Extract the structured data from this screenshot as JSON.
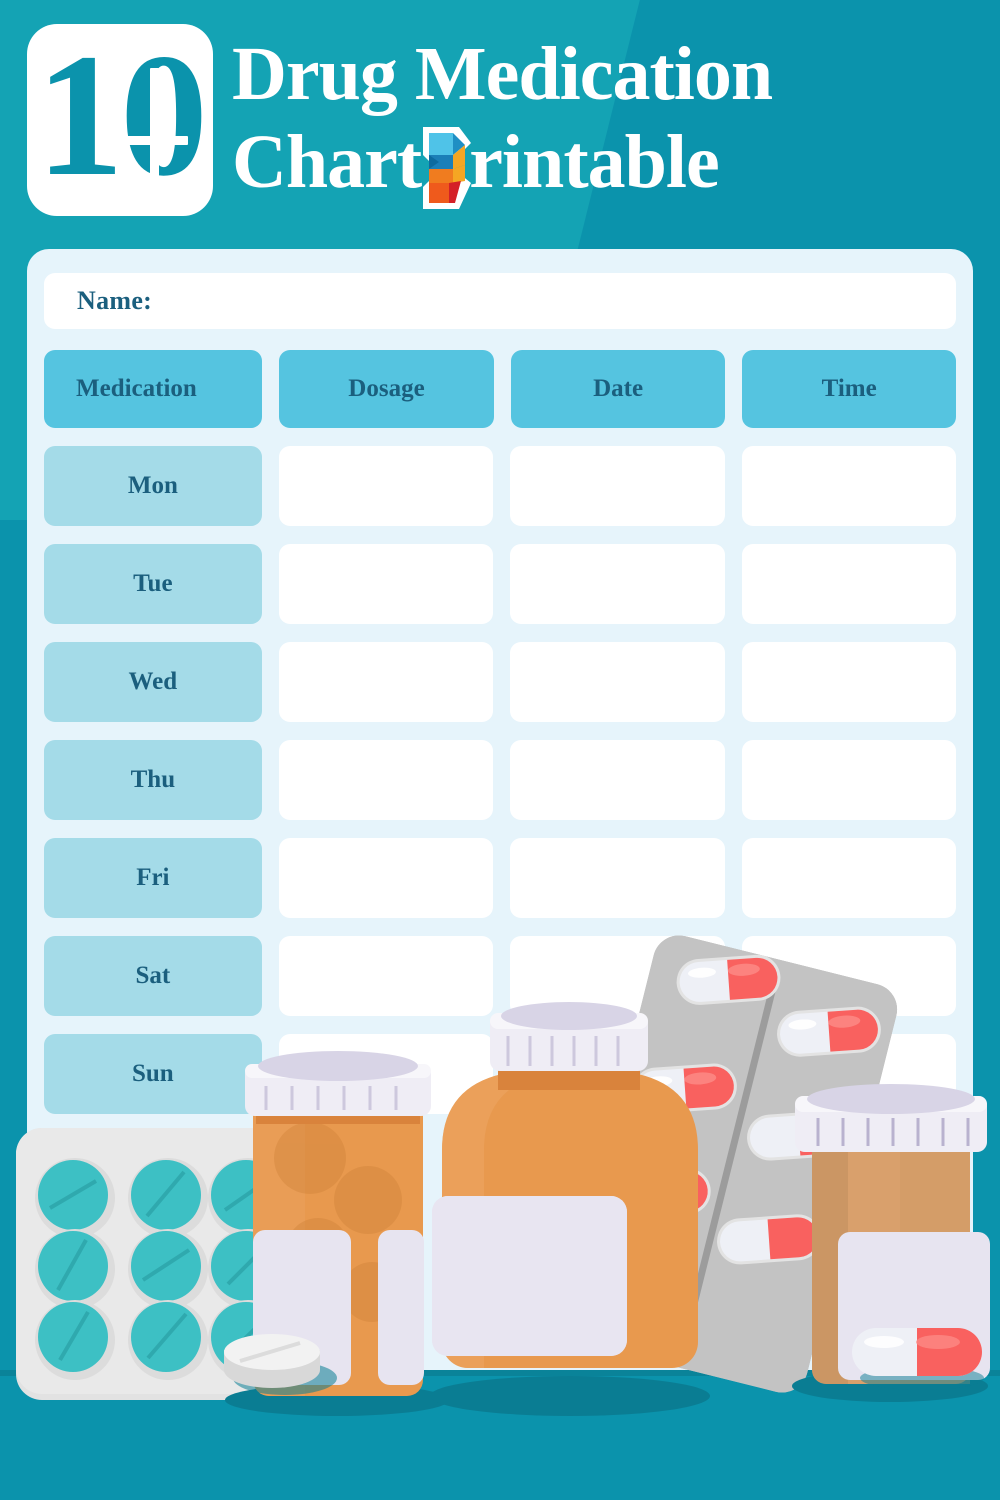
{
  "header": {
    "logo_number": "10",
    "logo_icon": "ten-cross-badge-icon",
    "title_line_1": "Drug Medication",
    "title_line_2_before": "Chart",
    "title_line_2_after": "rintable",
    "brand_mark": "printable-p-logo-icon"
  },
  "colors": {
    "page_background": "#0b93ac",
    "background_diagonal": "#14a3b4",
    "card_background": "#e6f4fb",
    "header_cell": "#55c4e0",
    "day_cell": "#a4dbe8",
    "blank_cell": "#ffffff",
    "text_dark": "#1b5f7e",
    "title_text": "#ffffff",
    "bottle_orange": "#e8994e",
    "bottle_orange_dark": "#d9833c",
    "cap_lavender": "#e4e0ef",
    "cap_white": "#f4f2f8",
    "blister_gray": "#b9b9b9",
    "blister_light": "#e8e8e8",
    "capsule_red": "#f9615f",
    "capsule_white": "#eef0f6",
    "tablet_teal": "#3dc0c4",
    "tablet_white": "#f0f0f0",
    "shadow": "#0a7d93"
  },
  "form": {
    "name_label": "Name:"
  },
  "chart_data": {
    "type": "table",
    "title": "Drug Medication Chart Printable",
    "columns": [
      "Medication",
      "Dosage",
      "Date",
      "Time"
    ],
    "rows": [
      {
        "day": "Mon",
        "medication": "",
        "dosage": "",
        "date": "",
        "time": ""
      },
      {
        "day": "Tue",
        "medication": "",
        "dosage": "",
        "date": "",
        "time": ""
      },
      {
        "day": "Wed",
        "medication": "",
        "dosage": "",
        "date": "",
        "time": ""
      },
      {
        "day": "Thu",
        "medication": "",
        "dosage": "",
        "date": "",
        "time": ""
      },
      {
        "day": "Fri",
        "medication": "",
        "dosage": "",
        "date": "",
        "time": ""
      },
      {
        "day": "Sat",
        "medication": "",
        "dosage": "",
        "date": "",
        "time": ""
      },
      {
        "day": "Sun",
        "medication": "",
        "dosage": "",
        "date": "",
        "time": ""
      }
    ],
    "notes": "Blank printable weekly medication log; all data cells empty."
  },
  "illustration": {
    "items": [
      "blister-pack-teal-tablets",
      "pill-bottle-left",
      "pill-bottle-center-large",
      "blister-pack-red-capsules",
      "pill-bottle-right",
      "loose-white-tablet",
      "loose-red-capsule"
    ]
  }
}
